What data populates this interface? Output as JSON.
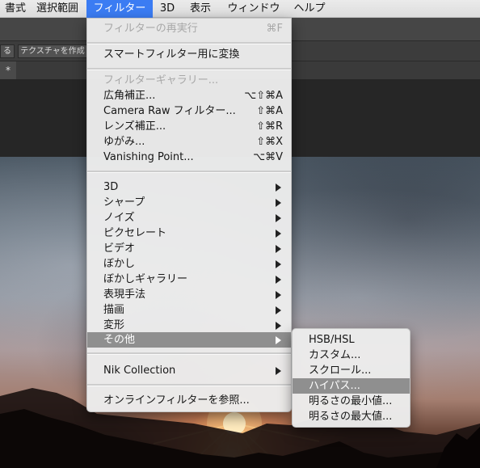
{
  "menubar": {
    "items": [
      {
        "label": "書式",
        "active": false
      },
      {
        "label": "選択範囲",
        "active": false
      },
      {
        "label": "フィルター",
        "active": true
      },
      {
        "label": "3D",
        "active": false
      },
      {
        "label": "表示",
        "active": false
      },
      {
        "label": "ウィンドウ",
        "active": false
      },
      {
        "label": "ヘルプ",
        "active": false
      }
    ]
  },
  "toolbar": {
    "left_button_label": "る",
    "texture_button_label": "テクスチャを作成"
  },
  "document_tab": {
    "label": "*"
  },
  "filter_menu": {
    "items": [
      {
        "label": "フィルターの再実行",
        "shortcut": "⌘F",
        "disabled": true
      },
      {
        "label": "スマートフィルター用に変換",
        "shortcut": ""
      },
      {
        "label": "フィルターギャラリー...",
        "shortcut": "",
        "disabled": true
      },
      {
        "label": "広角補正...",
        "shortcut": "⌥⇧⌘A"
      },
      {
        "label": "Camera Raw フィルター...",
        "shortcut": "⇧⌘A"
      },
      {
        "label": "レンズ補正...",
        "shortcut": "⇧⌘R"
      },
      {
        "label": "ゆがみ...",
        "shortcut": "⇧⌘X"
      },
      {
        "label": "Vanishing Point...",
        "shortcut": "⌥⌘V"
      },
      {
        "label": "3D",
        "submenu": true
      },
      {
        "label": "シャープ",
        "submenu": true
      },
      {
        "label": "ノイズ",
        "submenu": true
      },
      {
        "label": "ピクセレート",
        "submenu": true
      },
      {
        "label": "ビデオ",
        "submenu": true
      },
      {
        "label": "ぼかし",
        "submenu": true
      },
      {
        "label": "ぼかしギャラリー",
        "submenu": true
      },
      {
        "label": "表現手法",
        "submenu": true
      },
      {
        "label": "描画",
        "submenu": true
      },
      {
        "label": "変形",
        "submenu": true
      },
      {
        "label": "その他",
        "submenu": true,
        "highlighted": true
      },
      {
        "label": "Nik Collection",
        "submenu": true
      },
      {
        "label": "オンラインフィルターを参照...",
        "shortcut": ""
      }
    ]
  },
  "other_submenu": {
    "items": [
      {
        "label": "HSB/HSL"
      },
      {
        "label": "カスタム..."
      },
      {
        "label": "スクロール..."
      },
      {
        "label": "ハイパス...",
        "highlighted": true
      },
      {
        "label": "明るさの最小値..."
      },
      {
        "label": "明るさの最大値..."
      }
    ]
  },
  "icons": {
    "submenu_arrow": "triangle-right-icon"
  }
}
